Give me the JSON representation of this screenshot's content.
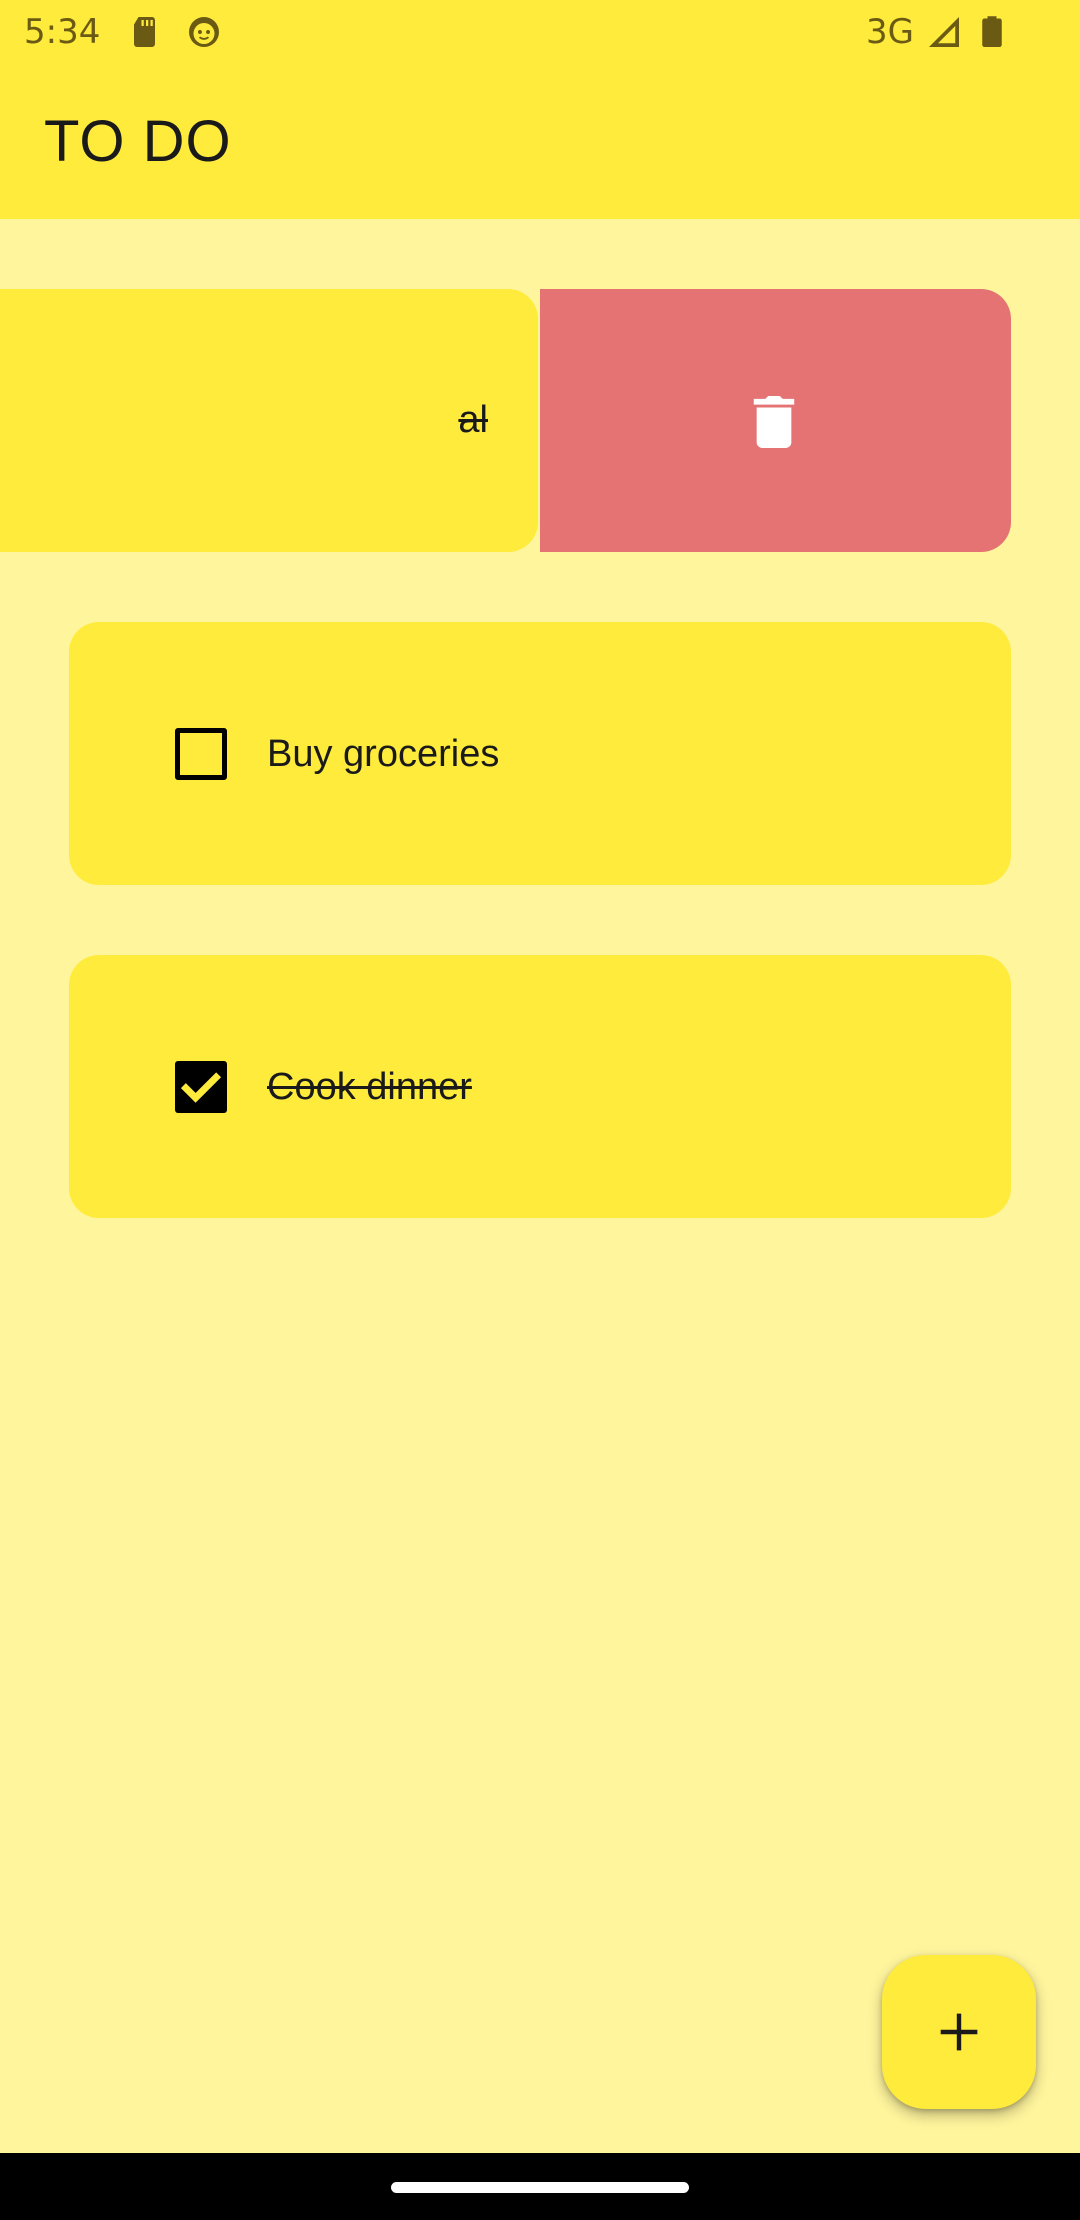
{
  "status_bar": {
    "time": "5:34",
    "network": "3G",
    "icons": [
      "sd-card-icon",
      "face-icon",
      "signal-icon",
      "battery-icon"
    ]
  },
  "app_bar": {
    "title": "TO DO"
  },
  "todos": [
    {
      "label": "al",
      "completed": true,
      "state": "swiped",
      "action_icon": "trash-icon"
    },
    {
      "label": "Buy groceries",
      "completed": false
    },
    {
      "label": "Cook dinner",
      "completed": true
    }
  ],
  "fab": {
    "icon": "plus-icon"
  },
  "colors": {
    "background": "#FFF59D",
    "bar": "#FFEB3B",
    "card": "#FFEB3B",
    "delete": "#E57373",
    "status_icons": "#6B5A14"
  }
}
